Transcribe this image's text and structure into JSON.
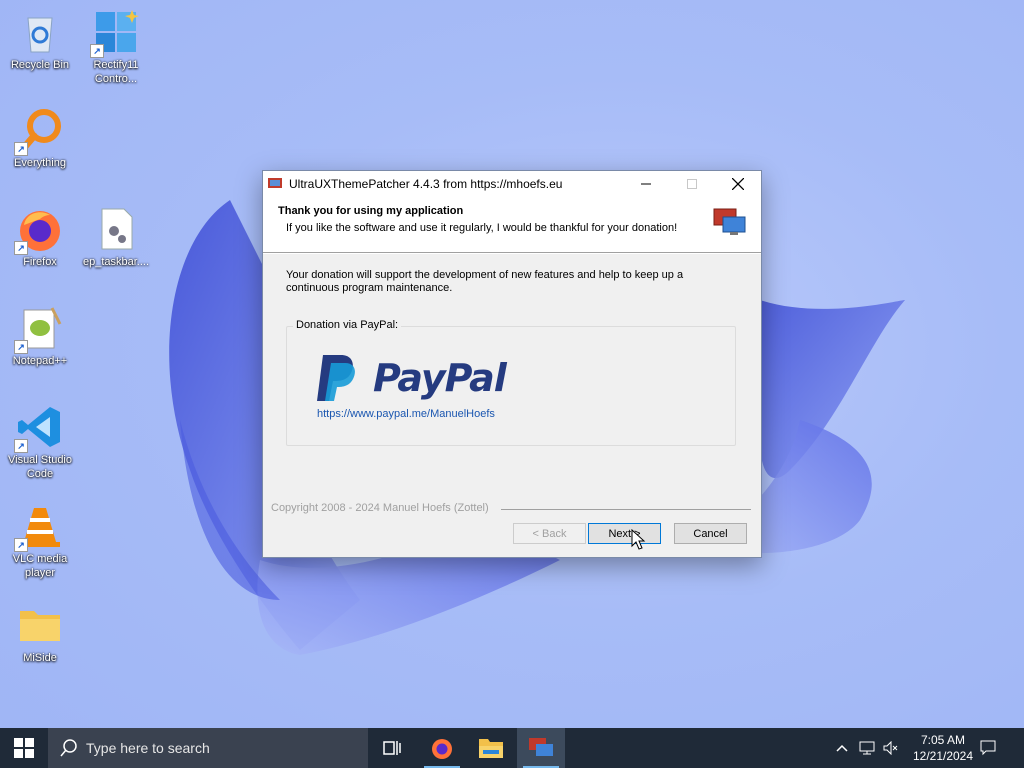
{
  "desktop": {
    "icons": [
      {
        "label": "Recycle Bin",
        "icon": "recycle-bin-icon"
      },
      {
        "label": "Rectify11 Contro...",
        "icon": "control-center-icon"
      },
      {
        "label": "Everything",
        "icon": "everything-search-icon"
      },
      {
        "label": "Firefox",
        "icon": "firefox-icon"
      },
      {
        "label": "ep_taskbar....",
        "icon": "settings-file-icon"
      },
      {
        "label": "Notepad++",
        "icon": "notepad-plus-plus-icon"
      },
      {
        "label": "Visual Studio Code",
        "icon": "vscode-icon"
      },
      {
        "label": "VLC media player",
        "icon": "vlc-icon"
      },
      {
        "label": "MiSide",
        "icon": "folder-icon"
      }
    ]
  },
  "dialog": {
    "title": "UltraUXThemePatcher 4.4.3 from https://mhoefs.eu",
    "header_title": "Thank you for using my application",
    "header_subtitle": "If you like the software and use it regularly, I would be thankful for your donation!",
    "intro": "Your donation will support the development of new features and help to keep up a continuous program maintenance.",
    "group_label": "Donation via PayPal:",
    "paypal_logo_text": "PayPal",
    "paypal_url": "https://www.paypal.me/ManuelHoefs",
    "copyright": "Copyright 2008 - 2024 Manuel Hoefs (Zottel)",
    "buttons": {
      "back": "< Back",
      "next": "Next >",
      "cancel": "Cancel"
    }
  },
  "taskbar": {
    "search_placeholder": "Type here to search",
    "time": "7:05 AM",
    "date": "12/21/2024"
  },
  "colors": {
    "taskbar_bg": "#1f2a38",
    "paypal_dark": "#253b80",
    "paypal_light": "#179bd7",
    "accent": "#0078d7"
  }
}
